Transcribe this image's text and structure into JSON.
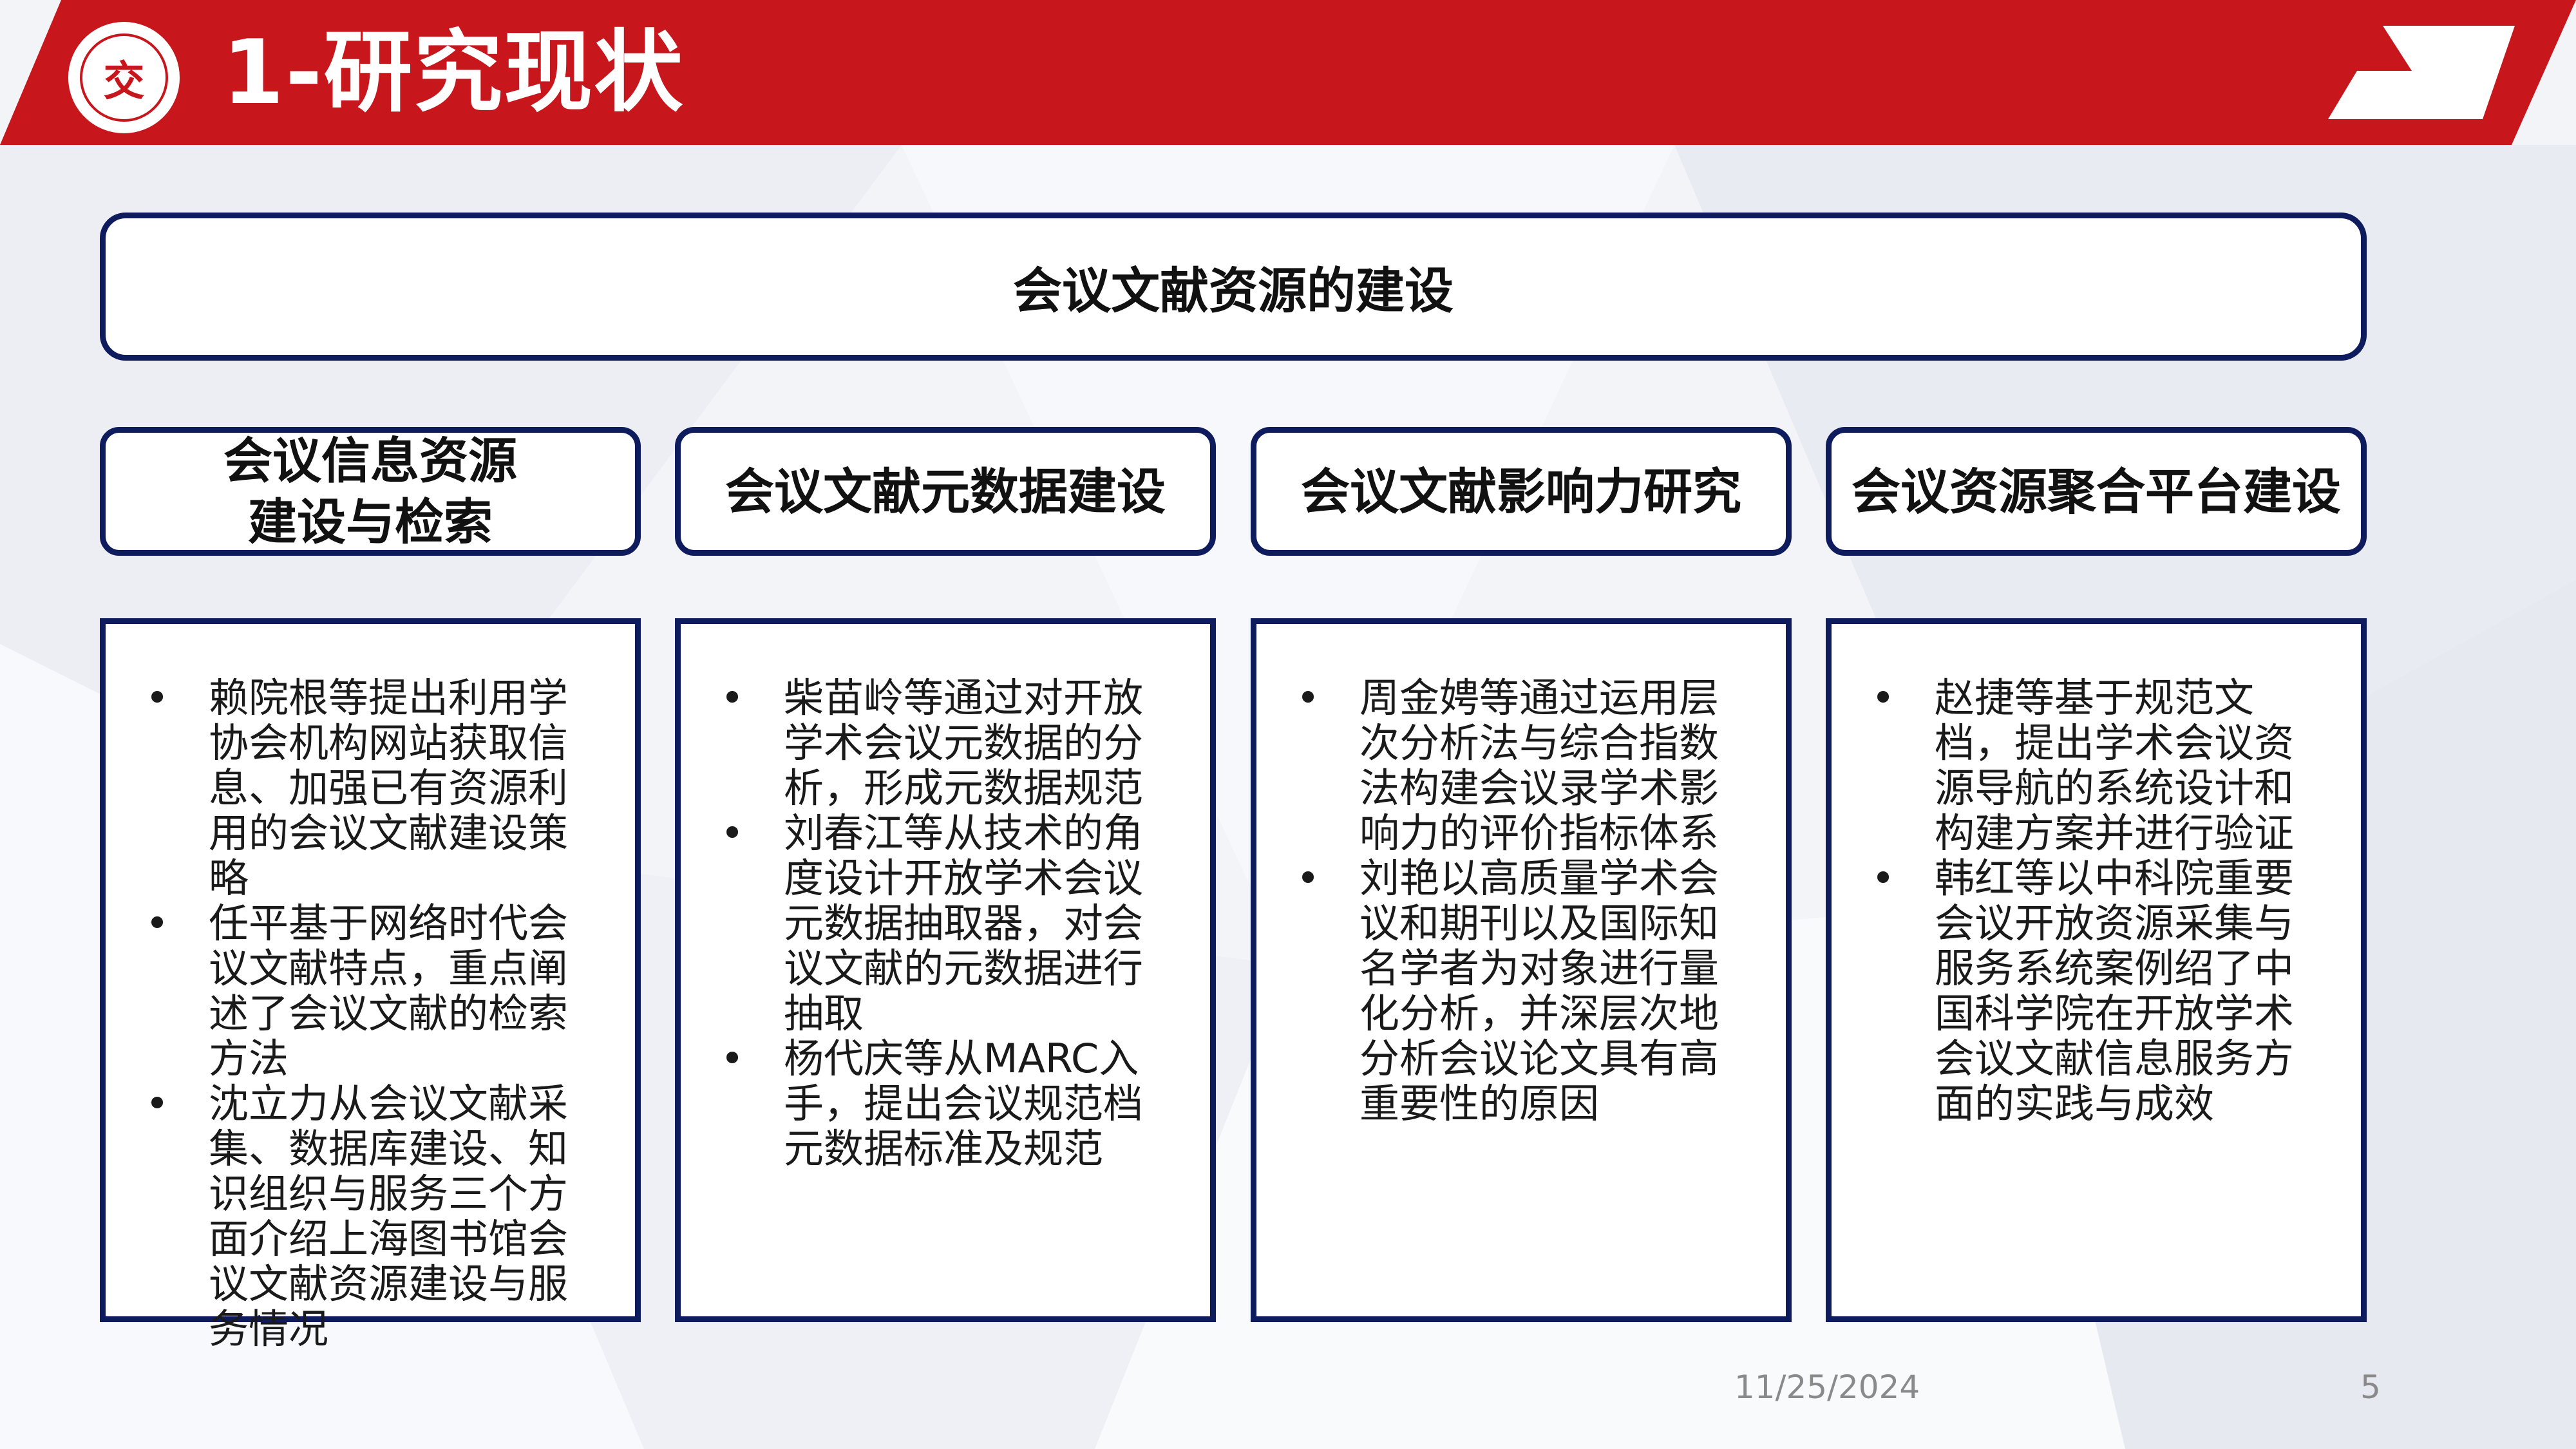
{
  "header": {
    "title": "1-研究现状",
    "logo_glyph": "交",
    "brand_color": "#c8161d"
  },
  "main_box": {
    "label": "会议文献资源的建设"
  },
  "columns": [
    {
      "heading": "会议信息资源\n建设与检索",
      "bullets": [
        "赖院根等提出利用学协会机构网站获取信息、加强已有资源利用的会议文献建设策略",
        "任平基于网络时代会议文献特点，重点阐述了会议文献的检索方法",
        "沈立力从会议文献采集、数据库建设、知识组织与服务三个方面介绍上海图书馆会议文献资源建设与服务情况"
      ]
    },
    {
      "heading": "会议文献元数据建设",
      "bullets": [
        "柴苗岭等通过对开放学术会议元数据的分析，形成元数据规范",
        "刘春江等从技术的角度设计开放学术会议元数据抽取器，对会议文献的元数据进行抽取",
        "杨代庆等从MARC入手，提出会议规范档元数据标准及规范"
      ]
    },
    {
      "heading": "会议文献影响力研究",
      "bullets": [
        "周金娉等通过运用层次分析法与综合指数法构建会议录学术影响力的评价指标体系",
        "刘艳以高质量学术会议和期刊以及国际知名学者为对象进行量化分析，并深层次地分析会议论文具有高重要性的原因"
      ]
    },
    {
      "heading": "会议资源聚合平台建设",
      "bullets": [
        "赵捷等基于规范文档，提出学术会议资源导航的系统设计和构建方案并进行验证",
        "韩红等以中科院重要会议开放资源采集与服务系统案例绍了中国科学院在开放学术会议文献信息服务方面的实践与成效"
      ]
    }
  ],
  "footer": {
    "date": "11/25/2024",
    "page_number": "5"
  }
}
